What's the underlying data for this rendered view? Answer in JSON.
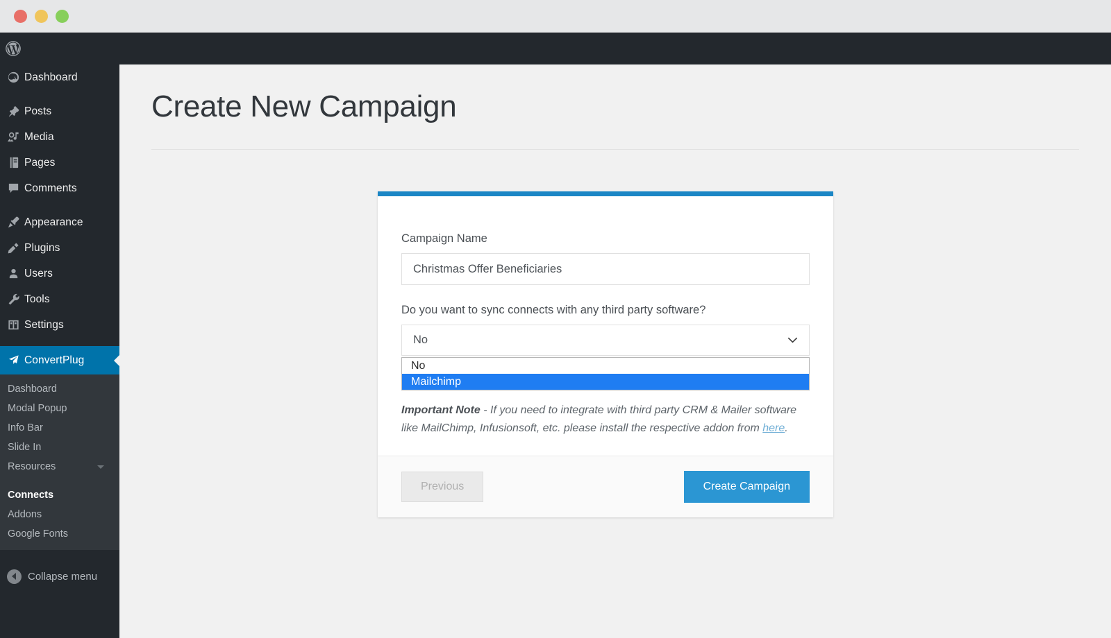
{
  "window": {
    "buttons": [
      "close",
      "minimize",
      "maximize"
    ]
  },
  "admin_bar": {
    "logo_icon": "wordpress-logo-icon"
  },
  "sidebar": {
    "items": [
      {
        "label": "Dashboard",
        "icon": "dashboard-icon"
      },
      {
        "label": "Posts",
        "icon": "pin-icon"
      },
      {
        "label": "Media",
        "icon": "media-icon"
      },
      {
        "label": "Pages",
        "icon": "pages-icon"
      },
      {
        "label": "Comments",
        "icon": "comment-icon"
      },
      {
        "label": "Appearance",
        "icon": "brush-icon"
      },
      {
        "label": "Plugins",
        "icon": "plugin-icon"
      },
      {
        "label": "Users",
        "icon": "user-icon"
      },
      {
        "label": "Tools",
        "icon": "wrench-icon"
      },
      {
        "label": "Settings",
        "icon": "settings-icon"
      }
    ],
    "active_item": {
      "label": "ConvertPlug",
      "icon": "convertplug-icon"
    },
    "submenu": [
      {
        "label": "Dashboard",
        "current": false,
        "caret": false
      },
      {
        "label": "Modal Popup",
        "current": false,
        "caret": false
      },
      {
        "label": "Info Bar",
        "current": false,
        "caret": false
      },
      {
        "label": "Slide In",
        "current": false,
        "caret": false
      },
      {
        "label": "Resources",
        "current": false,
        "caret": true
      },
      {
        "label": "Connects",
        "current": true,
        "caret": false
      },
      {
        "label": "Addons",
        "current": false,
        "caret": false
      },
      {
        "label": "Google Fonts",
        "current": false,
        "caret": false
      }
    ],
    "collapse_label": "Collapse menu",
    "collapse_icon": "collapse-arrow-icon",
    "active_color": "#0073aa",
    "background_color": "#23282d",
    "submenu_background": "#32373c"
  },
  "page": {
    "title": "Create New Campaign"
  },
  "card": {
    "accent_color": "#1b86c5",
    "campaign_name": {
      "label": "Campaign Name",
      "value": "Christmas Offer Beneficiaries",
      "placeholder": "Campaign Name"
    },
    "sync": {
      "label": "Do you want to sync connects with any third party software?",
      "selected": "No",
      "options": [
        {
          "label": "No",
          "selected": false
        },
        {
          "label": "Mailchimp",
          "selected": true
        }
      ],
      "highlight_color": "#1f7df2",
      "chevron_icon": "chevron-down-icon"
    },
    "note": {
      "strong": "Important Note",
      "text_before": " - If you need to integrate with third party CRM & Mailer software like MailChimp, Infusionsoft, etc. please install the respective addon from ",
      "link": "here",
      "text_after": "."
    },
    "footer": {
      "previous_label": "Previous",
      "create_label": "Create Campaign",
      "create_color": "#2b96d3"
    }
  }
}
